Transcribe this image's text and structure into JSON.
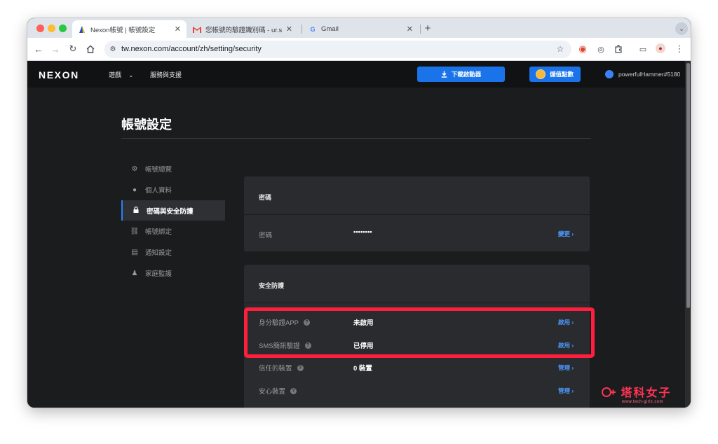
{
  "browser": {
    "tabs": [
      {
        "title": "Nexon帳號 | 帳號設定",
        "favicon": "nexon-icon",
        "active": true
      },
      {
        "title": "您帳號的驗證識別碼 - ur.stock",
        "favicon": "gmail-icon",
        "active": false
      },
      {
        "title": "Gmail",
        "favicon": "google-icon",
        "active": false
      }
    ],
    "url": "tw.nexon.com/account/zh/setting/security"
  },
  "site": {
    "logo": "NEXON",
    "nav": {
      "games": "遊戲",
      "support": "服務與支援"
    },
    "download_button": "下載啟動器",
    "points_button": "儲值點數",
    "username": "powerfulHammer#5180"
  },
  "page": {
    "title": "帳號設定",
    "sidebar": [
      {
        "label": "帳號總覽",
        "icon": "gear-icon",
        "active": false
      },
      {
        "label": "個人資料",
        "icon": "person-icon",
        "active": false
      },
      {
        "label": "密碼與安全防護",
        "icon": "lock-icon",
        "active": true
      },
      {
        "label": "帳號綁定",
        "icon": "link-icon",
        "active": false
      },
      {
        "label": "通知設定",
        "icon": "message-icon",
        "active": false
      },
      {
        "label": "家庭監護",
        "icon": "family-icon",
        "active": false
      }
    ],
    "password_panel": {
      "title": "密碼",
      "label": "密碼",
      "value": "••••••••",
      "action": "變更"
    },
    "security_panel": {
      "title": "安全防護",
      "rows": [
        {
          "label": "身分驗證APP",
          "value": "未啟用",
          "action": "啟用"
        },
        {
          "label": "SMS簡訊驗證",
          "value": "已停用",
          "action": "啟用"
        },
        {
          "label": "信任的裝置",
          "value": "0 裝置",
          "action": "管理"
        },
        {
          "label": "安心裝置",
          "value": "",
          "action": "管理"
        }
      ]
    }
  },
  "watermark": {
    "text": "塔科女子",
    "url": "www.tech-girlz.com"
  },
  "colors": {
    "accent": "#1a73e8",
    "highlight": "#ff1f3c",
    "link": "#4b9bff"
  }
}
